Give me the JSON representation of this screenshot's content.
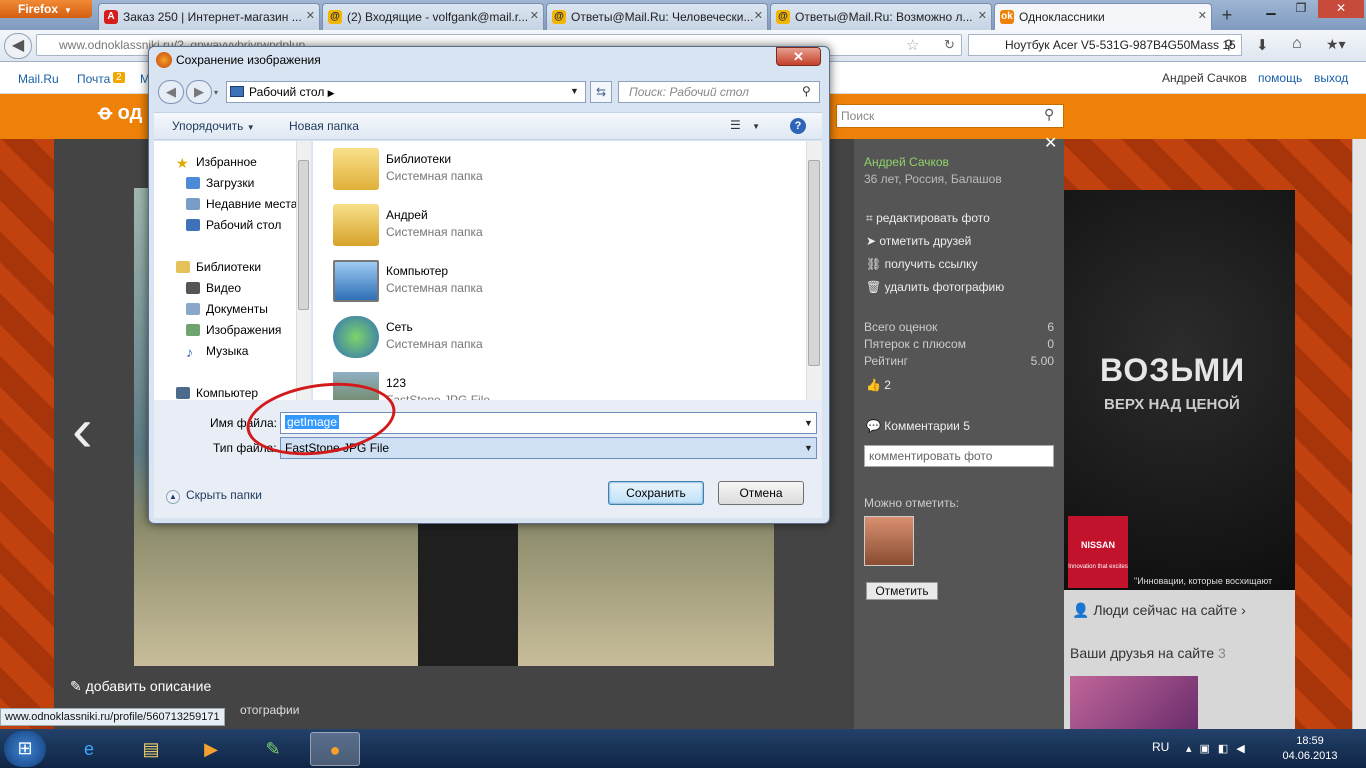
{
  "browser": {
    "menu_button": "Firefox",
    "tabs": [
      {
        "label": "Заказ 250 | Интернет-магазин ...",
        "icon": "red-a-icon"
      },
      {
        "label": "(2) Входящие - volfgank@mail.r...",
        "icon": "mailru-icon"
      },
      {
        "label": "Ответы@Mail.Ru: Человечески...",
        "icon": "otvety-icon"
      },
      {
        "label": "Ответы@Mail.Ru: Возможно л...",
        "icon": "otvety-icon"
      },
      {
        "label": "Одноклассники",
        "icon": "ok-icon"
      }
    ],
    "url": "www.odnoklassniki.ru/?_qpwayvybrivrwpdplup",
    "search_value": "Ноутбук Acer V5-531G-987B4G50Mass 15"
  },
  "mailru_bar": {
    "left_links": [
      "Mail.Ru",
      "Почта",
      "М"
    ],
    "mail_count": "2",
    "user": "Андрей Сачков",
    "help": "помощь",
    "logout": "выход"
  },
  "ok_header": {
    "logo": "од",
    "search_placeholder": "Поиск"
  },
  "photo_panel": {
    "owner": "Андрей Сачков",
    "owner_info": "36 лет, Россия, Балашов",
    "actions": [
      "редактировать фото",
      "отметить друзей",
      "получить ссылку",
      "удалить фотографию"
    ],
    "stats": [
      {
        "label": "Всего оценок",
        "value": "6"
      },
      {
        "label": "Пятерок с плюсом",
        "value": "0"
      },
      {
        "label": "Рейтинг",
        "value": "5.00"
      }
    ],
    "likes": "2",
    "comments": "Комментарии 5",
    "comment_placeholder": "комментировать фото",
    "can_mark": "Можно отметить:",
    "mark_button": "Отметить"
  },
  "viewer": {
    "add_description": "добавить описание",
    "partial_text": "отографии"
  },
  "ad": {
    "title": "ВОЗЬМИ",
    "subtitle": "ВЕРХ НАД ЦЕНОЙ",
    "brand": "NISSAN",
    "brand_tagline": "Innovation that excites",
    "slogan": "\"Инновации, которые восхищают"
  },
  "sidebar_right": {
    "people_online": "Люди сейчас на сайте ›",
    "friends_online": "Ваши друзья на сайте",
    "friends_count": "3"
  },
  "status_bar_url": "www.odnoklassniki.ru/profile/560713259171",
  "dialog": {
    "title": "Сохранение изображения",
    "location": "Рабочий стол",
    "search_placeholder": "Поиск: Рабочий стол",
    "organize": "Упорядочить",
    "new_folder": "Новая папка",
    "nav": [
      {
        "label": "Избранное",
        "icon": "star-icon",
        "level": 0
      },
      {
        "label": "Загрузки",
        "icon": "downloads-icon",
        "level": 1
      },
      {
        "label": "Недавние места",
        "icon": "recent-places-icon",
        "level": 1
      },
      {
        "label": "Рабочий стол",
        "icon": "desktop-icon",
        "level": 1
      },
      {
        "label": "Библиотеки",
        "icon": "libraries-icon",
        "level": 0
      },
      {
        "label": "Видео",
        "icon": "video-icon",
        "level": 1
      },
      {
        "label": "Документы",
        "icon": "documents-icon",
        "level": 1
      },
      {
        "label": "Изображения",
        "icon": "pictures-icon",
        "level": 1
      },
      {
        "label": "Музыка",
        "icon": "music-icon",
        "level": 1
      },
      {
        "label": "Компьютер",
        "icon": "computer-icon",
        "level": 0
      }
    ],
    "files": [
      {
        "name": "Библиотеки",
        "type": "Системная папка",
        "icon": "libraries-folder-icon"
      },
      {
        "name": "Андрей",
        "type": "Системная папка",
        "icon": "user-folder-icon"
      },
      {
        "name": "Компьютер",
        "type": "Системная папка",
        "icon": "computer-icon"
      },
      {
        "name": "Сеть",
        "type": "Системная папка",
        "icon": "network-icon"
      },
      {
        "name": "123",
        "type": "FastStone JPG File",
        "icon": "jpg-thumbnail-icon"
      }
    ],
    "filename_label": "Имя файла:",
    "filename_value": "getImage",
    "filetype_label": "Тип файла:",
    "filetype_value": "FastStone JPG File",
    "hide_folders": "Скрыть папки",
    "save": "Сохранить",
    "cancel": "Отмена"
  },
  "taskbar": {
    "lang": "RU",
    "time": "18:59",
    "date": "04.06.2013"
  },
  "colors": {
    "ok_orange": "#ee8208",
    "highlight_circle": "#d21a1a",
    "selection": "#3399ff"
  }
}
